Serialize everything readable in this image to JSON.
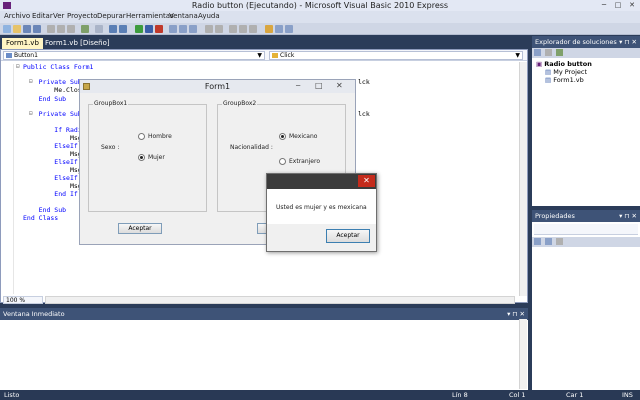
{
  "window": {
    "title": "Radio button (Ejecutando) - Microsoft Visual Basic 2010 Express",
    "controls": [
      "─",
      "□",
      "✕"
    ]
  },
  "menu": [
    "Archivo",
    "Editar",
    "Ver",
    "Proyecto",
    "Depurar",
    "Herramientas",
    "Ventana",
    "Ayuda"
  ],
  "doc_tabs": [
    "Form1.vb",
    "Form1.vb [Diseño]"
  ],
  "editor": {
    "object_combo": "Button1",
    "event_combo": "Click",
    "zoom": "100 %",
    "code_lines": [
      {
        "text": "Public Class Form1",
        "kind": "kw"
      },
      {
        "text": "    Private Sub",
        "kind": "kw"
      },
      {
        "text": "        Me.Close",
        "kind": "black"
      },
      {
        "text": "    End Sub",
        "kind": "kw"
      },
      {
        "text": "    Private Sub",
        "kind": "kw"
      },
      {
        "text": "        If Radio",
        "kind": "kw"
      },
      {
        "text": "            MsgB",
        "kind": "black"
      },
      {
        "text": "        ElseIf R",
        "kind": "kw"
      },
      {
        "text": "            MsgB",
        "kind": "black"
      },
      {
        "text": "        ElseIf R",
        "kind": "kw"
      },
      {
        "text": "            MsgB",
        "kind": "black"
      },
      {
        "text": "        ElseIf R",
        "kind": "kw"
      },
      {
        "text": "            MsgB",
        "kind": "black"
      },
      {
        "text": "        End If",
        "kind": "kw"
      },
      {
        "text": "    End Sub",
        "kind": "kw"
      },
      {
        "text": "End Class",
        "kind": "kw"
      }
    ],
    "right_fragment_1": "lck",
    "right_fragment_2": "lck"
  },
  "form1": {
    "title": "Form1",
    "group1": "GroupBox1",
    "group2": "GroupBox2",
    "sexo_label": "Sexo :",
    "hombre": "Hombre",
    "mujer": "Mujer",
    "nacionalidad_label": "Nacionalidad :",
    "mexicano": "Mexicano",
    "extranjero": "Extranjero",
    "aceptar": "Aceptar"
  },
  "msgbox": {
    "text": "Usted es mujer y es mexicana",
    "button": "Aceptar",
    "close": "✕"
  },
  "solution_explorer": {
    "title": "Explorador de soluciones",
    "root": "Radio button",
    "items": [
      "My Project",
      "Form1.vb"
    ]
  },
  "properties": {
    "title": "Propiedades"
  },
  "immediate": {
    "title": "Ventana Inmediato"
  },
  "status": {
    "left": "Listo",
    "lin": "Lín 8",
    "col": "Col 1",
    "car": "Car 1",
    "ins": "INS"
  }
}
